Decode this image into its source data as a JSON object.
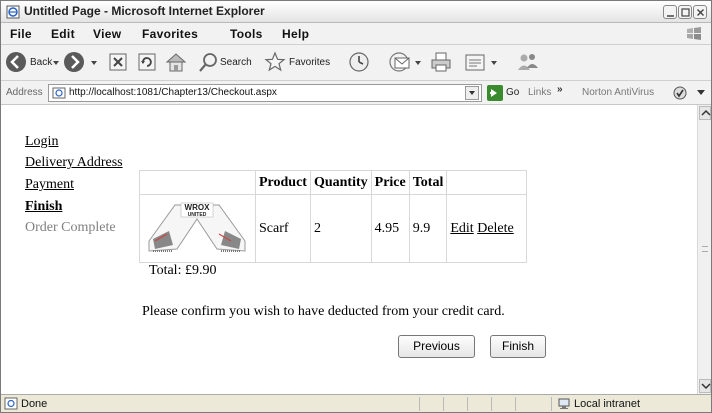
{
  "window": {
    "title": "Untitled Page - Microsoft Internet Explorer"
  },
  "menu": [
    "File",
    "Edit",
    "View",
    "Favorites",
    "Tools",
    "Help"
  ],
  "toolbar": {
    "back_label": "Back",
    "search_label": "Search",
    "favorites_label": "Favorites"
  },
  "address_bar": {
    "label": "Address",
    "url": "http://localhost:1081/Chapter13/Checkout.aspx",
    "go_label": "Go",
    "links_label": "Links",
    "links_chevron": "»",
    "norton_label": "Norton AntiVirus"
  },
  "wizard_nav": {
    "login": "Login",
    "delivery_address": "Delivery Address",
    "payment": "Payment",
    "finish": "Finish",
    "order_complete": "Order Complete"
  },
  "cart": {
    "headers": [
      "Product",
      "Quantity",
      "Price",
      "Total"
    ],
    "rows": [
      {
        "image_text": "WROX UNITED",
        "product": "Scarf",
        "quantity": "2",
        "price": "4.95",
        "total": "9.9",
        "edit_label": "Edit",
        "delete_label": "Delete"
      }
    ]
  },
  "order_total": "Total: £9.90",
  "confirm_message": "Please confirm you wish to have deducted from your credit card.",
  "buttons": {
    "previous": "Previous",
    "finish": "Finish"
  },
  "status_bar": {
    "status": "Done",
    "zone": "Local intranet"
  },
  "colors": {
    "chrome_bg": "#ece9d8",
    "nav_disabled": "#808080",
    "go_green": "#3a8a2e"
  },
  "icons": [
    "ie-page-icon",
    "windows-logo-icon",
    "back-arrow-icon",
    "forward-arrow-icon",
    "stop-icon",
    "refresh-icon",
    "home-icon",
    "search-icon",
    "favorites-star-icon",
    "history-icon",
    "mail-icon",
    "print-icon",
    "edit-icon",
    "messenger-icon",
    "go-arrow-icon",
    "norton-icon",
    "intranet-icon"
  ]
}
